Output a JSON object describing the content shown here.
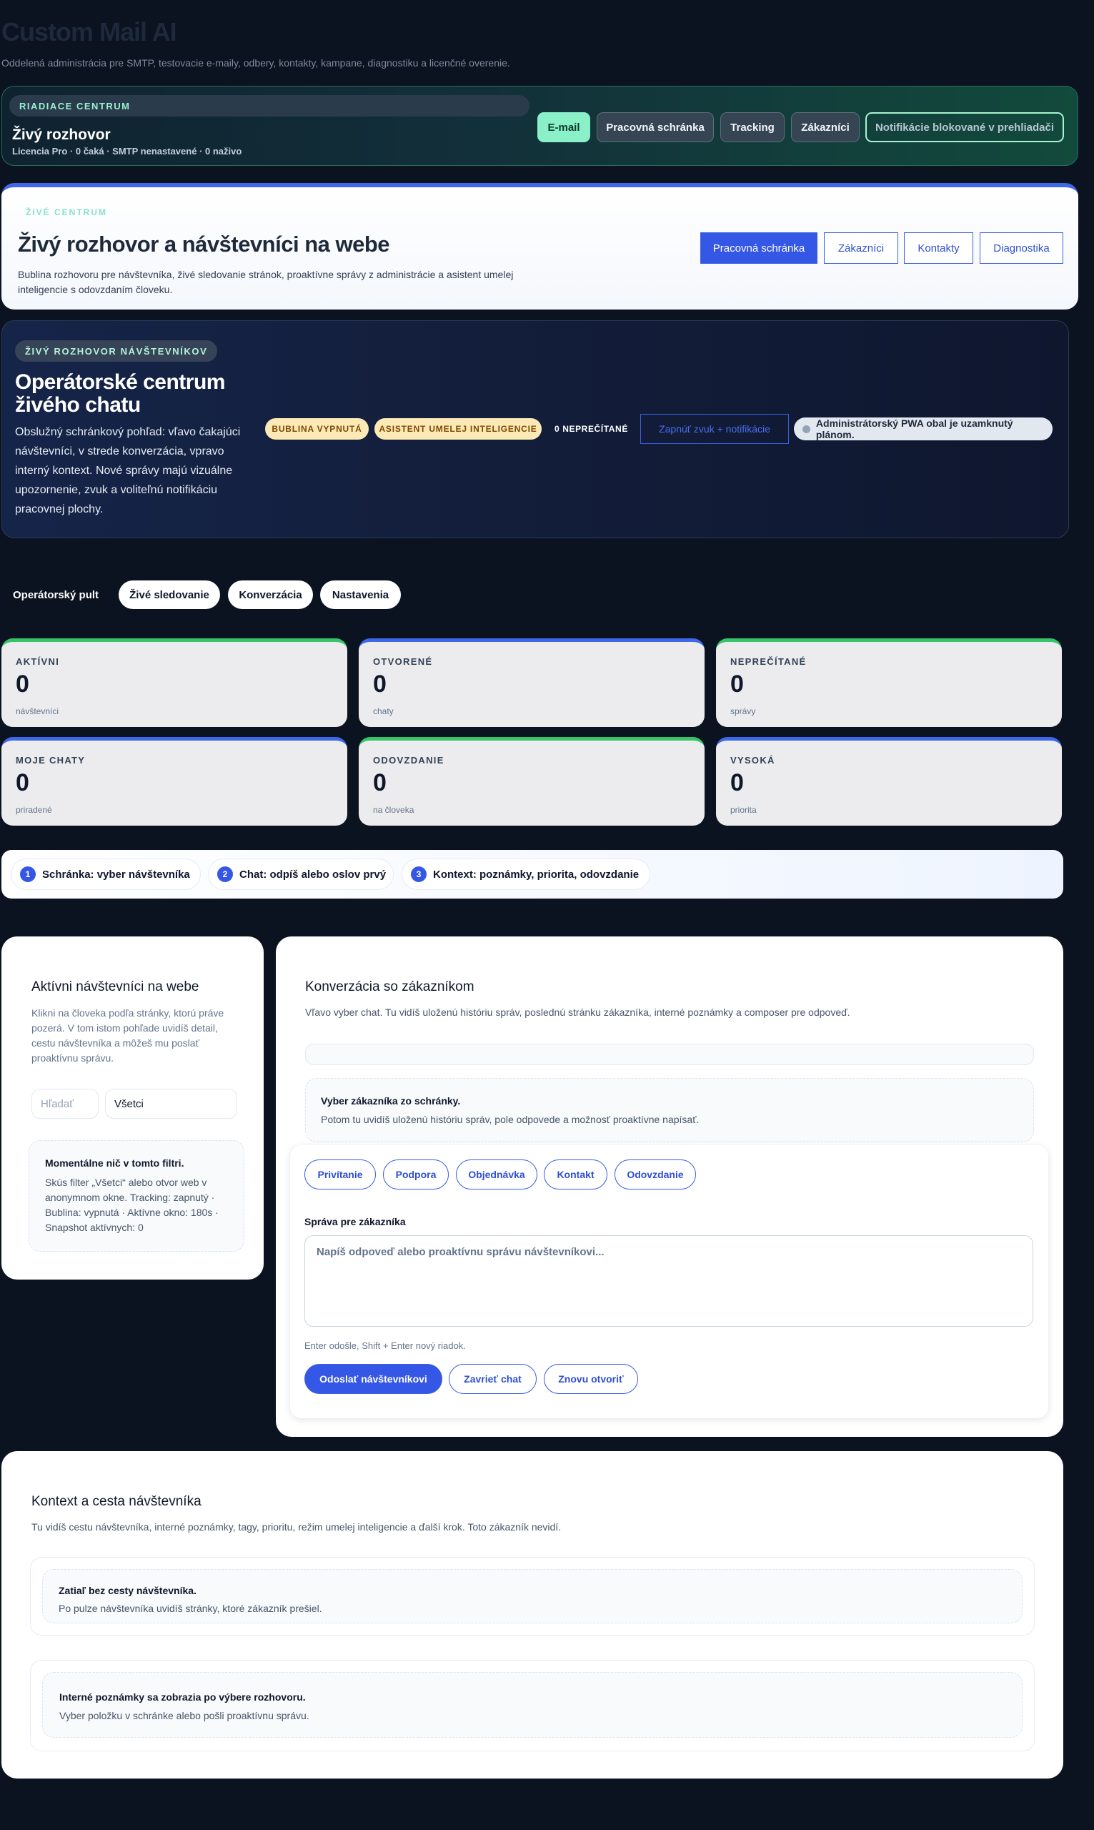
{
  "app": {
    "title": "Custom Mail AI",
    "subtitle": "Oddelená administrácia pre SMTP, testovacie e-maily, odbery, kontakty, kampane, diagnostiku a licenčné overenie."
  },
  "control": {
    "eyebrow": "RIADIACE CENTRUM",
    "title": "Živý rozhovor",
    "meta": "Licencia Pro · 0 čaká · SMTP nenastavené · 0 naživo",
    "buttons": [
      "E-mail",
      "Pracovná schránka",
      "Tracking",
      "Zákazníci",
      "Notifikácie blokované v prehliadači"
    ]
  },
  "hero": {
    "eyebrow": "ŽIVÉ CENTRUM",
    "title": "Živý rozhovor a návštevníci na webe",
    "desc": "Bublina rozhovoru pre návštevníka, živé sledovanie stránok, proaktívne správy z administrácie a asistent umelej inteligencie s odovzdaním človeku.",
    "buttons": [
      "Pracovná schránka",
      "Zákazníci",
      "Kontakty",
      "Diagnostika"
    ]
  },
  "operator": {
    "pill": "ŽIVÝ ROZHOVOR NÁVŠTEVNÍKOV",
    "title": "Operátorské centrum živého chatu",
    "desc": "Obslužný schránkový pohľad: vľavo čakajúci návštevníci, v strede konverzácia, vpravo interný kontext. Nové správy majú vizuálne upozornenie, zvuk a voliteľnú notifikáciu pracovnej plochy.",
    "badges": [
      "BUBLINA VYPNUTÁ",
      "ASISTENT UMELEJ INTELIGENCIE"
    ],
    "unread": "0 NEPREČÍTANÉ",
    "sound_button": "Zapnúť zvuk + notifikácie",
    "pwa": "Administrátorský PWA obal je uzamknutý plánom."
  },
  "tabs": [
    "Operátorský pult",
    "Živé sledovanie",
    "Konverzácia",
    "Nastavenia"
  ],
  "stats": [
    {
      "label": "AKTÍVNI",
      "value": "0",
      "unit": "návštevníci"
    },
    {
      "label": "OTVORENÉ",
      "value": "0",
      "unit": "chaty"
    },
    {
      "label": "NEPREČÍTANÉ",
      "value": "0",
      "unit": "správy"
    },
    {
      "label": "MOJE CHATY",
      "value": "0",
      "unit": "priradené"
    },
    {
      "label": "ODOVZDANIE",
      "value": "0",
      "unit": "na človeka"
    },
    {
      "label": "VYSOKÁ",
      "value": "0",
      "unit": "priorita"
    }
  ],
  "steps": [
    {
      "num": "1",
      "label": "Schránka: vyber návštevníka"
    },
    {
      "num": "2",
      "label": "Chat: odpíš alebo oslov prvý"
    },
    {
      "num": "3",
      "label": "Kontext: poznámky, priorita, odovzdanie"
    }
  ],
  "visitors": {
    "title": "Aktívni návštevníci na webe",
    "desc": "Klikni na človeka podľa stránky, ktorú práve pozerá. V tom istom pohľade uvidíš detail, cestu návštevníka a môžeš mu poslať proaktívnu správu.",
    "search_placeholder": "Hľadať",
    "filter_value": "Všetci",
    "empty_title": "Momentálne nič v tomto filtri.",
    "empty_desc": "Skús filter „Všetci“ alebo otvor web v anonymnom okne. Tracking: zapnutý · Bublina: vypnutá · Aktívne okno: 180s · Snapshot aktívnych: 0"
  },
  "conversation": {
    "title": "Konverzácia so zákazníkom",
    "desc": "Vľavo vyber chat. Tu vidíš uloženú históriu správ, poslednú stránku zákazníka, interné poznámky a composer pre odpoveď.",
    "empty_title": "Vyber zákazníka zo schránky.",
    "empty_desc": "Potom tu uvidíš uloženú históriu správ, pole odpovede a možnosť proaktívne napísať.",
    "quick_replies": [
      "Privítanie",
      "Podpora",
      "Objednávka",
      "Kontakt",
      "Odovzdanie"
    ],
    "message_label": "Správa pre zákazníka",
    "message_placeholder": "Napíš odpoveď alebo proaktívnu správu návštevníkovi...",
    "hint": "Enter odošle, Shift + Enter nový riadok.",
    "actions": [
      "Odoslať návštevníkovi",
      "Zavrieť chat",
      "Znovu otvoriť"
    ]
  },
  "context": {
    "title": "Kontext a cesta návštevníka",
    "desc": "Tu vidíš cestu návštevníka, interné poznámky, tagy, prioritu, režim umelej inteligencie a ďalší krok. Toto zákazník nevidí.",
    "journey_title": "Zatiaľ bez cesty návštevníka.",
    "journey_desc": "Po pulze návštevníka uvidíš stránky, ktoré zákazník prešiel.",
    "notes_title": "Interné poznámky sa zobrazia po výbere rozhovoru.",
    "notes_desc": "Vyber položku v schránke alebo pošli proaktívnu správu."
  }
}
